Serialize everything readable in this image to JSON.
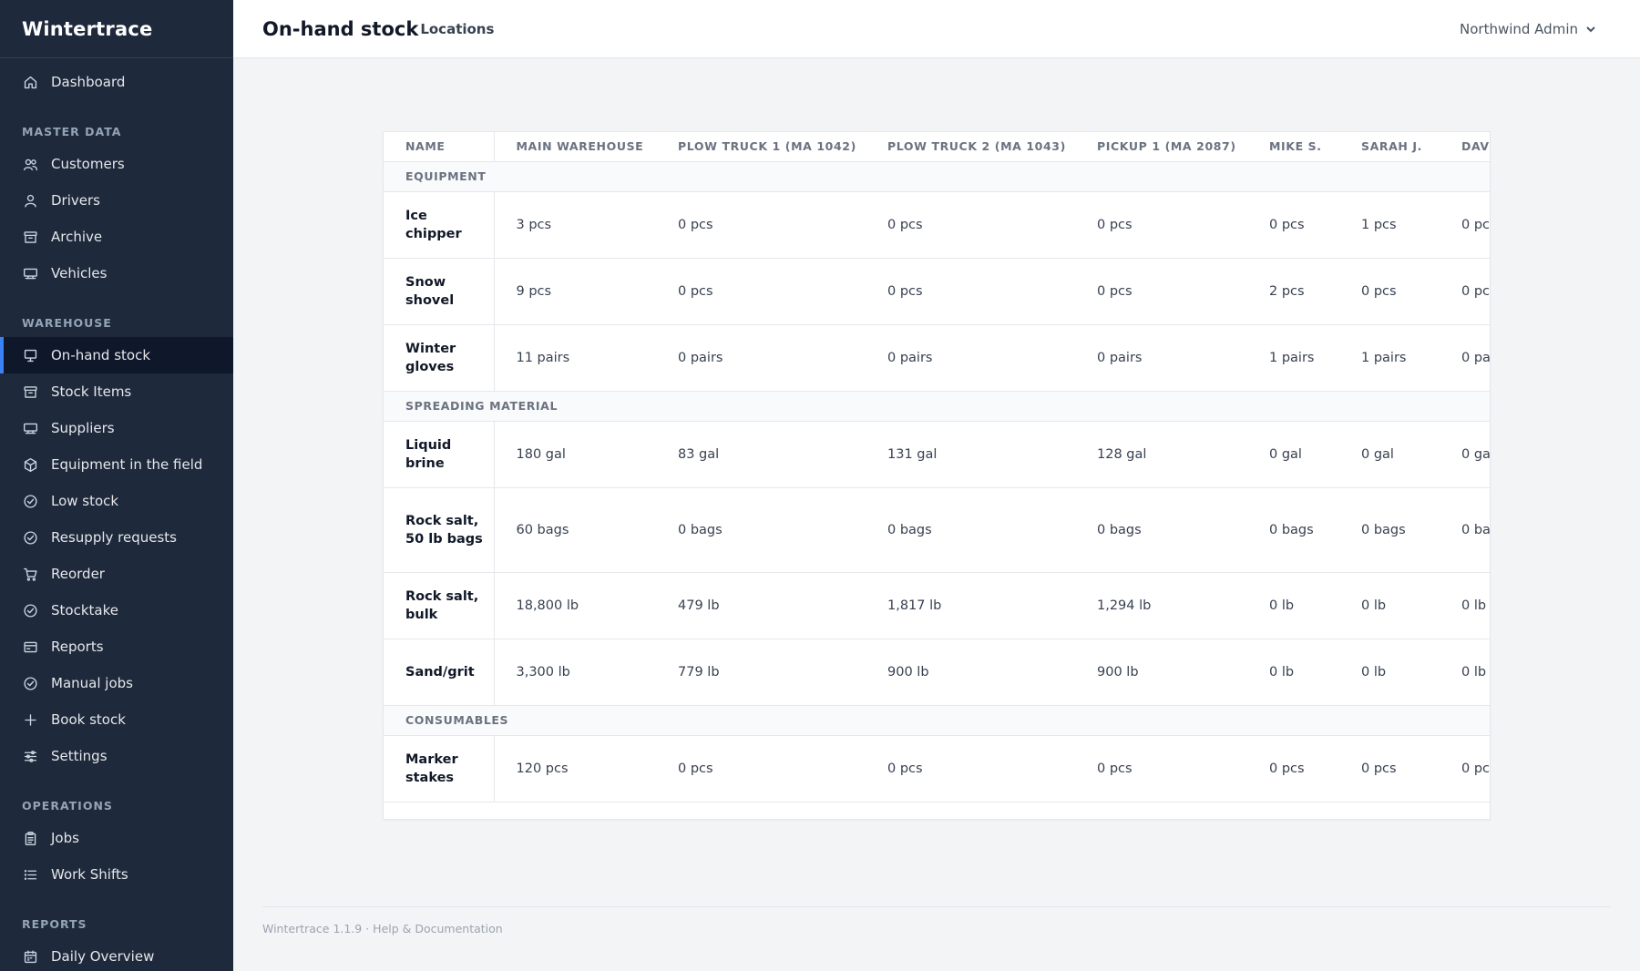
{
  "app": {
    "name": "Wintertrace"
  },
  "sidebar": {
    "top": [
      {
        "label": "Dashboard",
        "icon": "home-icon"
      }
    ],
    "sections": [
      {
        "title": "MASTER DATA",
        "items": [
          {
            "label": "Customers",
            "icon": "users-icon"
          },
          {
            "label": "Drivers",
            "icon": "user-icon"
          },
          {
            "label": "Archive",
            "icon": "archive-icon"
          },
          {
            "label": "Vehicles",
            "icon": "truck-icon"
          }
        ]
      },
      {
        "title": "WAREHOUSE",
        "items": [
          {
            "label": "On-hand stock",
            "icon": "monitor-icon",
            "active": true
          },
          {
            "label": "Stock Items",
            "icon": "archive-icon"
          },
          {
            "label": "Suppliers",
            "icon": "truck-icon"
          },
          {
            "label": "Equipment in the field",
            "icon": "cube-icon"
          },
          {
            "label": "Low stock",
            "icon": "check-circle-icon"
          },
          {
            "label": "Resupply requests",
            "icon": "check-circle-icon"
          },
          {
            "label": "Reorder",
            "icon": "cart-icon"
          },
          {
            "label": "Stocktake",
            "icon": "check-circle-icon"
          },
          {
            "label": "Reports",
            "icon": "card-icon"
          },
          {
            "label": "Manual jobs",
            "icon": "check-circle-icon"
          },
          {
            "label": "Book stock",
            "icon": "plus-icon"
          },
          {
            "label": "Settings",
            "icon": "sliders-icon"
          }
        ]
      },
      {
        "title": "OPERATIONS",
        "items": [
          {
            "label": "Jobs",
            "icon": "clipboard-icon"
          },
          {
            "label": "Work Shifts",
            "icon": "list-icon"
          }
        ]
      },
      {
        "title": "REPORTS",
        "items": [
          {
            "label": "Daily Overview",
            "icon": "calendar-icon"
          }
        ]
      }
    ]
  },
  "header": {
    "title": "On-hand stock",
    "link": "Locations",
    "user": "Northwind Admin"
  },
  "table": {
    "columns": [
      "NAME",
      "MAIN WAREHOUSE",
      "PLOW TRUCK 1 (MA 1042)",
      "PLOW TRUCK 2 (MA 1043)",
      "PICKUP 1 (MA 2087)",
      "MIKE S.",
      "SARAH J.",
      "DAVI"
    ],
    "groups": [
      {
        "title": "EQUIPMENT",
        "rows": [
          {
            "name": "Ice chipper",
            "values": [
              "3 pcs",
              "0 pcs",
              "0 pcs",
              "0 pcs",
              "0 pcs",
              "1 pcs",
              "0 pc"
            ]
          },
          {
            "name": "Snow shovel",
            "values": [
              "9 pcs",
              "0 pcs",
              "0 pcs",
              "0 pcs",
              "2 pcs",
              "0 pcs",
              "0 pc"
            ]
          },
          {
            "name": "Winter gloves",
            "values": [
              "11 pairs",
              "0 pairs",
              "0 pairs",
              "0 pairs",
              "1 pairs",
              "1 pairs",
              "0 pa"
            ]
          }
        ]
      },
      {
        "title": "SPREADING MATERIAL",
        "rows": [
          {
            "name": "Liquid brine",
            "values": [
              "180 gal",
              "83 gal",
              "131 gal",
              "128 gal",
              "0 gal",
              "0 gal",
              "0 ga"
            ]
          },
          {
            "name": "Rock salt, 50 lb bags",
            "values": [
              "60 bags",
              "0 bags",
              "0 bags",
              "0 bags",
              "0 bags",
              "0 bags",
              "0 ba"
            ]
          },
          {
            "name": "Rock salt, bulk",
            "values": [
              "18,800 lb",
              "479 lb",
              "1,817 lb",
              "1,294 lb",
              "0 lb",
              "0 lb",
              "0 lb"
            ]
          },
          {
            "name": "Sand/grit",
            "values": [
              "3,300 lb",
              "779 lb",
              "900 lb",
              "900 lb",
              "0 lb",
              "0 lb",
              "0 lb"
            ]
          }
        ]
      },
      {
        "title": "CONSUMABLES",
        "rows": [
          {
            "name": "Marker stakes",
            "values": [
              "120 pcs",
              "0 pcs",
              "0 pcs",
              "0 pcs",
              "0 pcs",
              "0 pcs",
              "0 pc"
            ]
          }
        ]
      }
    ]
  },
  "footer": {
    "text": "Wintertrace 1.1.9 · Help & Documentation"
  },
  "colors": {
    "sidebar": "#1e293b",
    "active": "#0f172a",
    "accent": "#3b82f6"
  }
}
